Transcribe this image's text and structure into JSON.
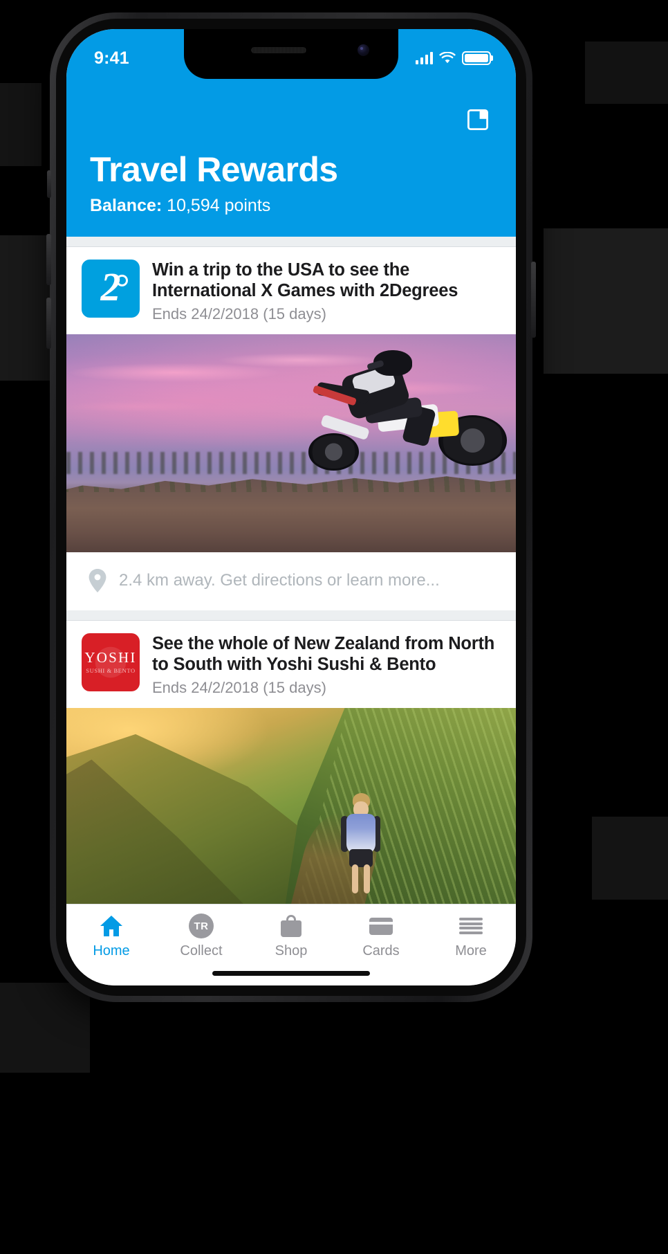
{
  "status_bar": {
    "time": "9:41",
    "signal_icon": "cellular-bars-icon",
    "wifi_icon": "wifi-icon",
    "battery_icon": "battery-full-icon"
  },
  "header": {
    "title": "Travel Rewards",
    "balance_label": "Balance:",
    "balance_value": " 10,594 points",
    "accent_color": "#039be5",
    "action_icon": "panels-layout-icon"
  },
  "offers": [
    {
      "brand_logo": "2degrees-logo",
      "logo_glyph": "2",
      "logo_color": "#00a0df",
      "title": "Win a trip to the USA to see the International X Games with 2Degrees",
      "ends": "Ends 24/2/2018 (15 days)",
      "photo": "motocross-rider-jumping-at-dusk",
      "location_icon": "map-pin-icon",
      "location_text": "2.4 km away. Get directions or learn more..."
    },
    {
      "brand_logo": "yoshi-sushi-bento-logo",
      "logo_text": "YOSHI",
      "logo_subtext": "SUSHI & BENTO",
      "logo_color": "#d81f26",
      "title": "See the whole of New Zealand from North to South with Yoshi Sushi & Bento",
      "ends": "Ends 24/2/2018 (15 days)",
      "photo": "hiker-on-sunrise-mountain-ridge"
    }
  ],
  "tab_bar": {
    "items": [
      {
        "label": "Home",
        "icon": "home-icon",
        "active": true
      },
      {
        "label": "Collect",
        "icon": "tr-badge-icon",
        "active": false
      },
      {
        "label": "Shop",
        "icon": "shopping-bag-icon",
        "active": false
      },
      {
        "label": "Cards",
        "icon": "card-icon",
        "active": false
      },
      {
        "label": "More",
        "icon": "menu-icon",
        "active": false
      }
    ],
    "active_color": "#039be5",
    "inactive_color": "#8e8e93"
  }
}
